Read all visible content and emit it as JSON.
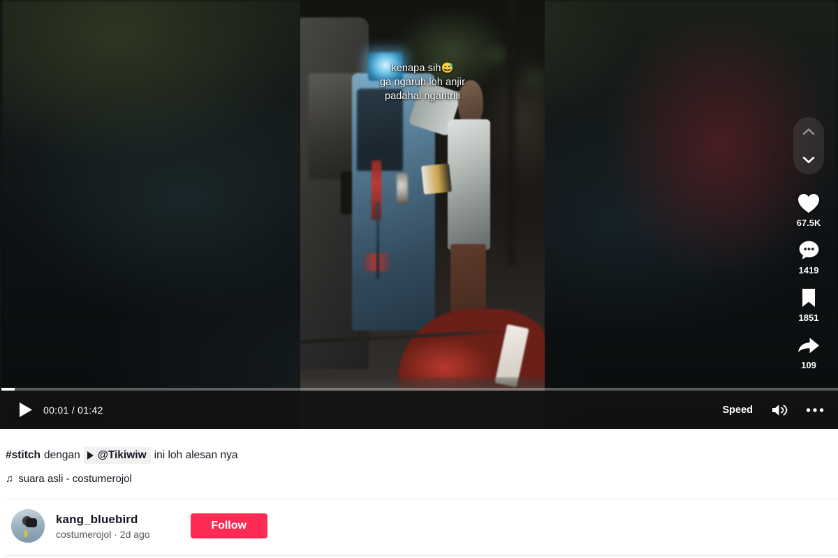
{
  "player": {
    "video_overlay_caption": [
      "kenapa sih😅",
      "ga ngaruh loh anjir",
      "padahal ngantriii"
    ],
    "controls": {
      "play_icon": "play-icon",
      "current_time": "00:01",
      "separator": "/",
      "duration": "01:42",
      "time_display": "00:01 / 01:42",
      "speed_label": "Speed",
      "volume_icon": "volume-on-icon",
      "more_icon": "more-options-icon",
      "progress_percent": 1.6
    },
    "navigation": {
      "previous_icon": "chevron-up-icon",
      "next_icon": "chevron-down-icon"
    },
    "actions": [
      {
        "name": "like",
        "icon": "heart-icon",
        "count": "67.5K"
      },
      {
        "name": "comment",
        "icon": "comment-icon",
        "count": "1419"
      },
      {
        "name": "bookmark",
        "icon": "bookmark-icon",
        "count": "1851"
      },
      {
        "name": "share",
        "icon": "share-arrow-icon",
        "count": "109"
      }
    ]
  },
  "post": {
    "caption": {
      "hashtag": "#stitch",
      "connector": "dengan",
      "mention": "@Tikiwiw",
      "mention_play_icon": "play-triangle-icon",
      "trailing_text": "ini loh alesan nya"
    },
    "music": {
      "note_icon": "♫",
      "label": "suara asli - costumerojol"
    }
  },
  "author": {
    "avatar_icon": "user-avatar",
    "username": "kang_bluebird",
    "subtitle": "costumerojol · 2d ago",
    "follow_label": "Follow",
    "follow_color": "#fe2c55"
  }
}
